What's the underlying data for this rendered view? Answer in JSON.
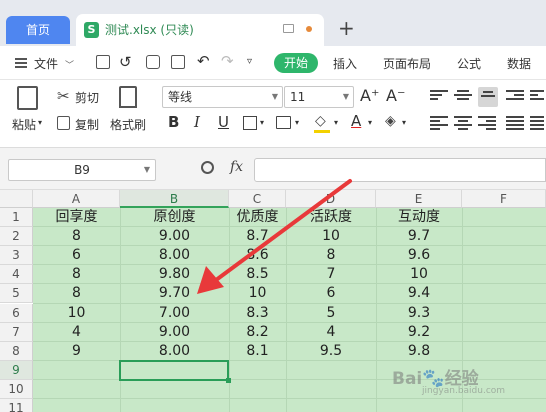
{
  "tabs": {
    "home": "首页",
    "file_name": "测试.xlsx (只读)",
    "file_icon_letter": "S",
    "new_tab": "+"
  },
  "menu": {
    "file_label": "文件",
    "items": [
      "开始",
      "插入",
      "页面布局",
      "公式",
      "数据"
    ],
    "active_index": 0
  },
  "ribbon": {
    "paste_label": "粘贴",
    "cut_label": "剪切",
    "copy_label": "复制",
    "format_painter_label": "格式刷",
    "font_name": "等线",
    "font_size": "11",
    "bold": "B",
    "italic": "I",
    "underline": "U",
    "font_grow": "A⁺",
    "font_shrink": "A⁻",
    "font_color_glyph": "A"
  },
  "formula_bar": {
    "name_box": "B9",
    "fx_label": "fx",
    "value": ""
  },
  "sheet": {
    "columns": [
      "A",
      "B",
      "C",
      "D",
      "E",
      "F"
    ],
    "selected_column": "B",
    "rows": [
      "1",
      "2",
      "3",
      "4",
      "5",
      "6",
      "7",
      "8",
      "9",
      "10",
      "11"
    ],
    "selected_row": "9",
    "headers": [
      "回享度",
      "原创度",
      "优质度",
      "活跃度",
      "互动度"
    ],
    "data": [
      [
        "8",
        "9.00",
        "8.7",
        "10",
        "9.7"
      ],
      [
        "6",
        "8.00",
        "8.6",
        "8",
        "9.6"
      ],
      [
        "8",
        "9.80",
        "8.5",
        "7",
        "10"
      ],
      [
        "8",
        "9.70",
        "10",
        "6",
        "9.4"
      ],
      [
        "10",
        "7.00",
        "8.3",
        "5",
        "9.3"
      ],
      [
        "4",
        "9.00",
        "8.2",
        "4",
        "9.2"
      ],
      [
        "9",
        "8.00",
        "8.1",
        "9.5",
        "9.8"
      ]
    ],
    "fill_color": "#c8e8c8"
  },
  "annotation": {
    "arrow_color": "#e8393a"
  },
  "watermark": {
    "text": "Bai",
    "suffix": "经验",
    "sub": "jingyan.baidu.com"
  }
}
